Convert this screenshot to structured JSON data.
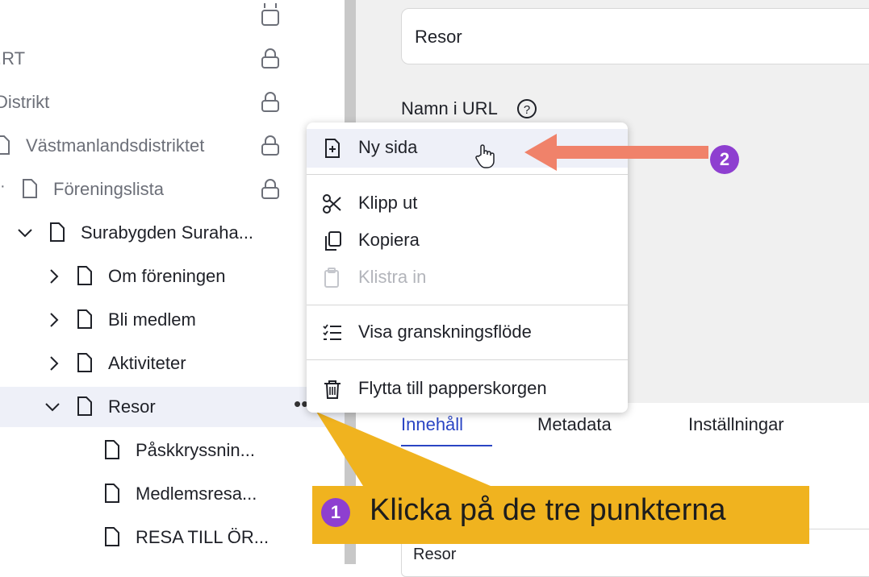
{
  "tree": {
    "items": [
      {
        "label": ".RT"
      },
      {
        "label": "Distrikt"
      },
      {
        "label": "Västmanlandsdistriktet"
      },
      {
        "label": "Föreningslista"
      },
      {
        "label": "Surabygden Suraha..."
      },
      {
        "label": "Om föreningen"
      },
      {
        "label": "Bli medlem"
      },
      {
        "label": "Aktiviteter"
      },
      {
        "label": "Resor"
      },
      {
        "label": "Påskkryssnin..."
      },
      {
        "label": "Medlemsresa..."
      },
      {
        "label": "RESA TILL ÖR..."
      }
    ],
    "more_button": "••"
  },
  "main": {
    "title_value": "Resor",
    "url_label": "Namn i URL",
    "tabs": [
      {
        "label": "Innehåll"
      },
      {
        "label": "Metadata"
      },
      {
        "label": "Inställningar"
      }
    ],
    "bottom_field_value": "Resor"
  },
  "context_menu": {
    "items": [
      {
        "label": "Ny sida",
        "icon": "new-page-icon"
      },
      {
        "label": "Klipp ut",
        "icon": "scissors-icon"
      },
      {
        "label": "Kopiera",
        "icon": "copy-icon"
      },
      {
        "label": "Klistra in",
        "icon": "paste-icon",
        "disabled": true
      },
      {
        "label": "Visa granskningsflöde",
        "icon": "checklist-icon"
      },
      {
        "label": "Flytta till papperskorgen",
        "icon": "trash-icon"
      }
    ]
  },
  "annotations": {
    "callout_text": "Klicka på de tre punkterna",
    "badge_1": "1",
    "badge_2": "2",
    "callout_color": "#f0b31f",
    "arrow_color": "#f0826a",
    "badge_color": "#8e3fd0"
  }
}
